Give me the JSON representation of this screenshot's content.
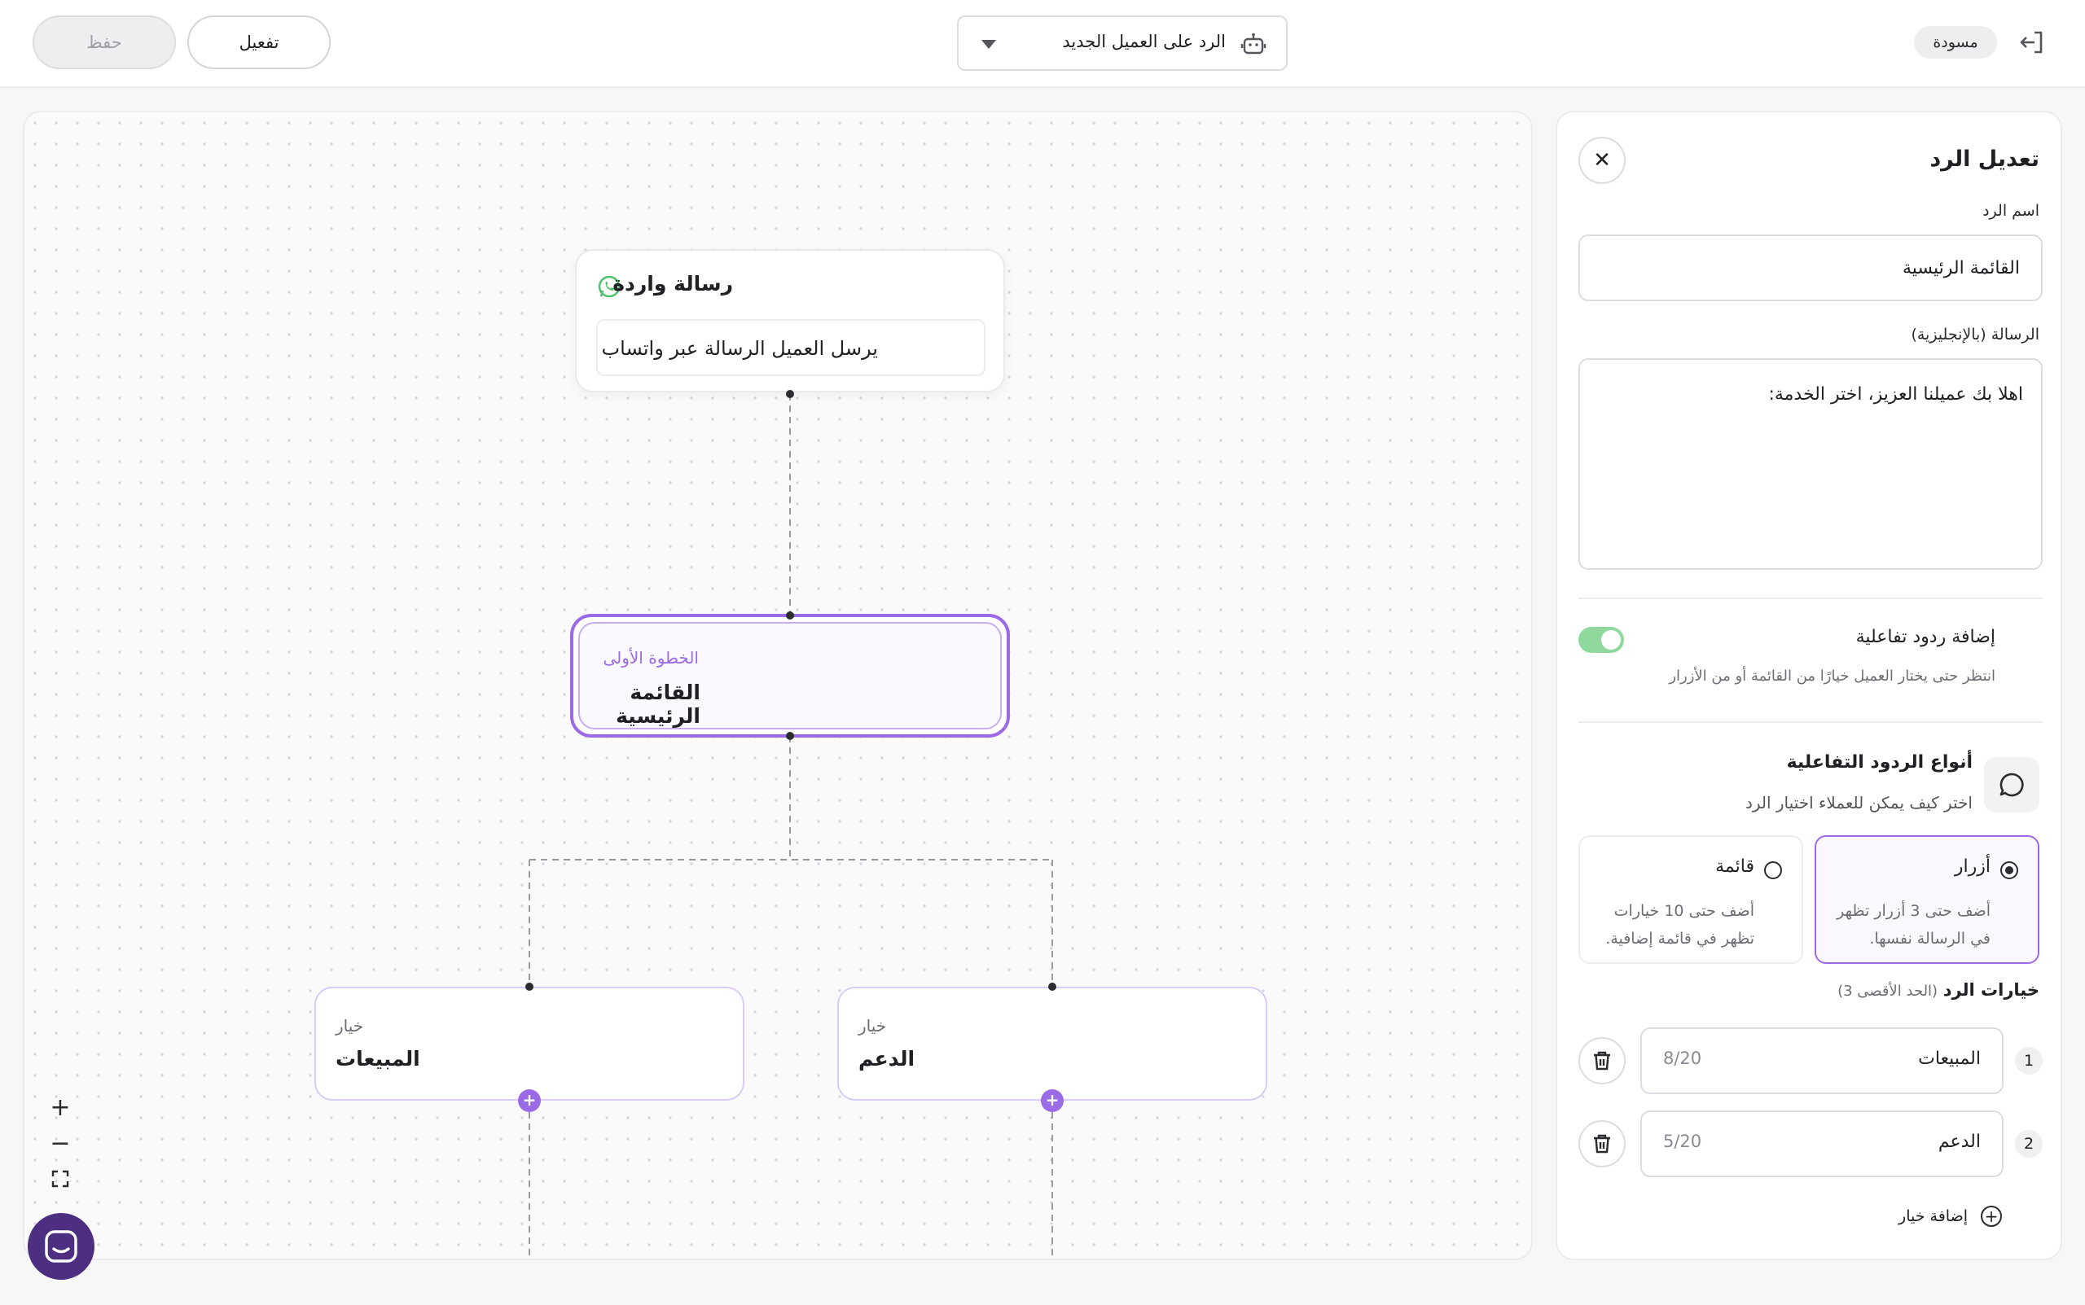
{
  "header": {
    "save_label": "حفظ",
    "activate_label": "تفعيل",
    "flow_name": "الرد على العميل الجديد",
    "status_badge": "مسودة",
    "icons": {
      "bot": "robot-icon",
      "exit": "exit-icon",
      "caret": "chevron-down-icon"
    }
  },
  "canvas": {
    "incoming_node": {
      "title": "رسالة واردة",
      "description": "يرسل العميل الرسالة عبر واتساب",
      "icon": "whatsapp-icon"
    },
    "main_node": {
      "subtitle": "الخطوة الأولى",
      "title": "القائمة الرئيسية"
    },
    "option_nodes": [
      {
        "subtitle": "خيار",
        "title": "المبيعات"
      },
      {
        "subtitle": "خيار",
        "title": "الدعم"
      }
    ],
    "zoom": {
      "in": "+",
      "out": "−"
    }
  },
  "panel": {
    "title": "تعديل الرد",
    "name_label": "اسم الرد",
    "name_value": "القائمة الرئيسية",
    "message_label": "الرسالة (بالإنجليزية)",
    "message_value": "اهلا بك عميلنا العزيز، اختر الخدمة:",
    "interactive_title": "إضافة ردود تفاعلية",
    "interactive_desc": "انتظر حتى يختار العميل خيارًا من القائمة أو من الأزرار",
    "interactive_enabled": true,
    "types_title": "أنواع الردود التفاعلية",
    "types_desc": "اختر كيف يمكن للعملاء اختيار الرد",
    "types": [
      {
        "title": "أزرار",
        "desc": "أضف حتى 3 أزرار تظهر في الرسالة نفسها.",
        "selected": true
      },
      {
        "title": "قائمة",
        "desc": "أضف حتى 10 خيارات تظهر في قائمة إضافية.",
        "selected": false
      }
    ],
    "options_title": "خيارات الرد",
    "options_limit": "(الحد الأقصى 3)",
    "options": [
      {
        "index": "1",
        "value": "المبيعات",
        "count": "8/20"
      },
      {
        "index": "2",
        "value": "الدعم",
        "count": "5/20"
      }
    ],
    "add_option_label": "إضافة خيار"
  },
  "colors": {
    "accent": "#9b6ae6",
    "toggle_on": "#8fd99c",
    "launcher": "#4d2f82",
    "whatsapp": "#4fc36b"
  }
}
